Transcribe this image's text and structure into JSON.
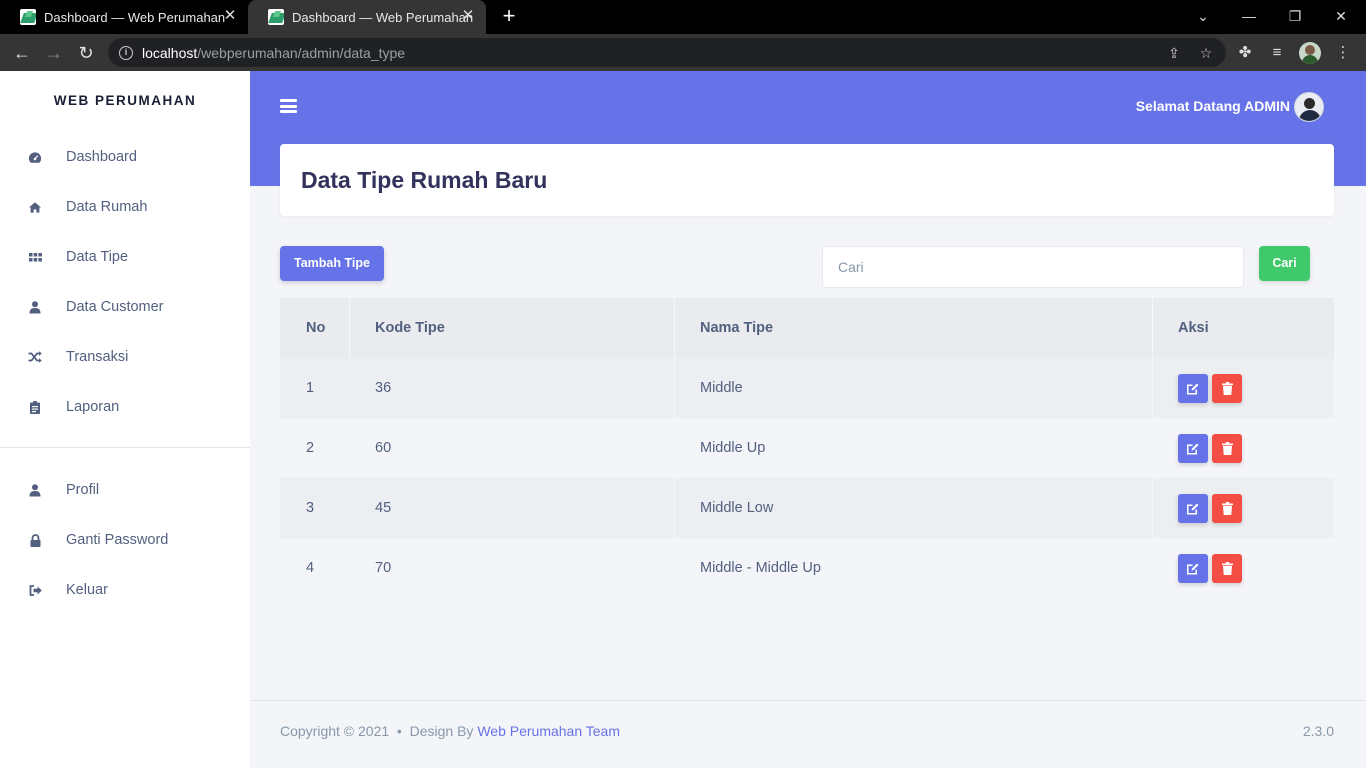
{
  "browser": {
    "tabs": [
      {
        "title": "Dashboard — Web Perumahan"
      },
      {
        "title": "Dashboard — Web Perumahan"
      }
    ],
    "url_host": "localhost",
    "url_path": "/webperumahan/admin/data_type"
  },
  "sidebar": {
    "brand": "WEB PERUMAHAN",
    "items": [
      {
        "label": "Dashboard",
        "icon": "dashboard-icon"
      },
      {
        "label": "Data Rumah",
        "icon": "home-icon"
      },
      {
        "label": "Data Tipe",
        "icon": "grid-icon"
      },
      {
        "label": "Data Customer",
        "icon": "user-icon"
      },
      {
        "label": "Transaksi",
        "icon": "shuffle-icon"
      },
      {
        "label": "Laporan",
        "icon": "clipboard-icon"
      }
    ],
    "bottom_items": [
      {
        "label": "Profil",
        "icon": "user-icon"
      },
      {
        "label": "Ganti Password",
        "icon": "lock-icon"
      },
      {
        "label": "Keluar",
        "icon": "sign-out-icon"
      }
    ]
  },
  "header": {
    "welcome": "Selamat Datang ADMIN"
  },
  "page": {
    "title": "Data Tipe Rumah Baru",
    "add_button": "Tambah Tipe",
    "search_placeholder": "Cari",
    "search_button": "Cari"
  },
  "table": {
    "columns": [
      "No",
      "Kode Tipe",
      "Nama Tipe",
      "Aksi"
    ],
    "rows": [
      {
        "no": "1",
        "kode": "36",
        "nama": "Middle"
      },
      {
        "no": "2",
        "kode": "60",
        "nama": "Middle Up"
      },
      {
        "no": "3",
        "kode": "45",
        "nama": "Middle Low"
      },
      {
        "no": "4",
        "kode": "70",
        "nama": "Middle - Middle Up"
      }
    ]
  },
  "footer": {
    "copyright": "Copyright © 2021",
    "design_by": "Design By",
    "team": "Web Perumahan Team",
    "version": "2.3.0"
  },
  "colors": {
    "primary": "#6673e8",
    "success": "#3fc96a",
    "danger": "#f44d43"
  }
}
